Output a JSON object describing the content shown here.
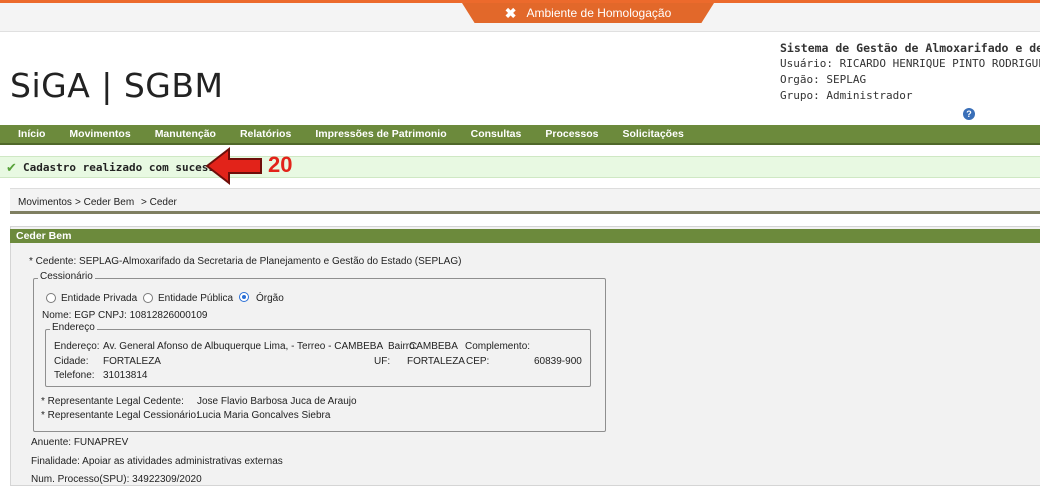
{
  "env": {
    "label": "Ambiente de Homologação"
  },
  "logo": {
    "text": "SiGA | SGBM"
  },
  "system": {
    "title": "Sistema de Gestão de Almoxarifado e de Ber",
    "user": "Usuário: RICARDO HENRIQUE PINTO RODRIGUES",
    "orgao": "Orgão: SEPLAG",
    "grupo": "Grupo: Administrador"
  },
  "menu": [
    "Início",
    "Movimentos",
    "Manutenção",
    "Relatórios",
    "Impressões de Patrimonio",
    "Consultas",
    "Processos",
    "Solicitações"
  ],
  "success": {
    "message": "Cadastro realizado com sucesso."
  },
  "annotation": {
    "number": "20"
  },
  "breadcrumb": {
    "items": [
      "Movimentos",
      "> Ceder Bem",
      "> Ceder"
    ]
  },
  "panel": {
    "title": "Ceder Bem",
    "cedente": "* Cedente: SEPLAG-Almoxarifado da Secretaria de Planejamento e Gestão do Estado (SEPLAG)",
    "cessionario": {
      "legend": "Cessionário",
      "options": [
        "Entidade Privada",
        "Entidade Pública",
        "Órgão"
      ],
      "selected": "Órgão",
      "nome": "Nome: EGP CNPJ: 10812826000109",
      "endereco": {
        "legend": "Endereço",
        "endereco_label": "Endereço:",
        "endereco_value": "Av. General Afonso de Albuquerque Lima, - Terreo - CAMBEBA",
        "bairro_label": "Bairro:",
        "bairro_value": "CAMBEBA",
        "complemento_label": "Complemento:",
        "cidade_label": "Cidade:",
        "cidade_value": "FORTALEZA",
        "uf_label": "UF:",
        "uf_value": "FORTALEZA",
        "cep_label": "CEP:",
        "cep_value": "60839-900",
        "telefone_label": "Telefone:",
        "telefone_value": "31013814"
      },
      "rep_cedente_label": "* Representante Legal Cedente:",
      "rep_cedente_value": "Jose Flavio Barbosa Juca de Araujo",
      "rep_cessionario_label": "* Representante Legal Cessionário:",
      "rep_cessionario_value": "Lucia Maria Goncalves Siebra"
    },
    "anuente": "Anuente: FUNAPREV",
    "finalidade": "Finalidade: Apoiar as atividades administrativas externas",
    "processo": "Num. Processo(SPU): 34922309/2020"
  }
}
